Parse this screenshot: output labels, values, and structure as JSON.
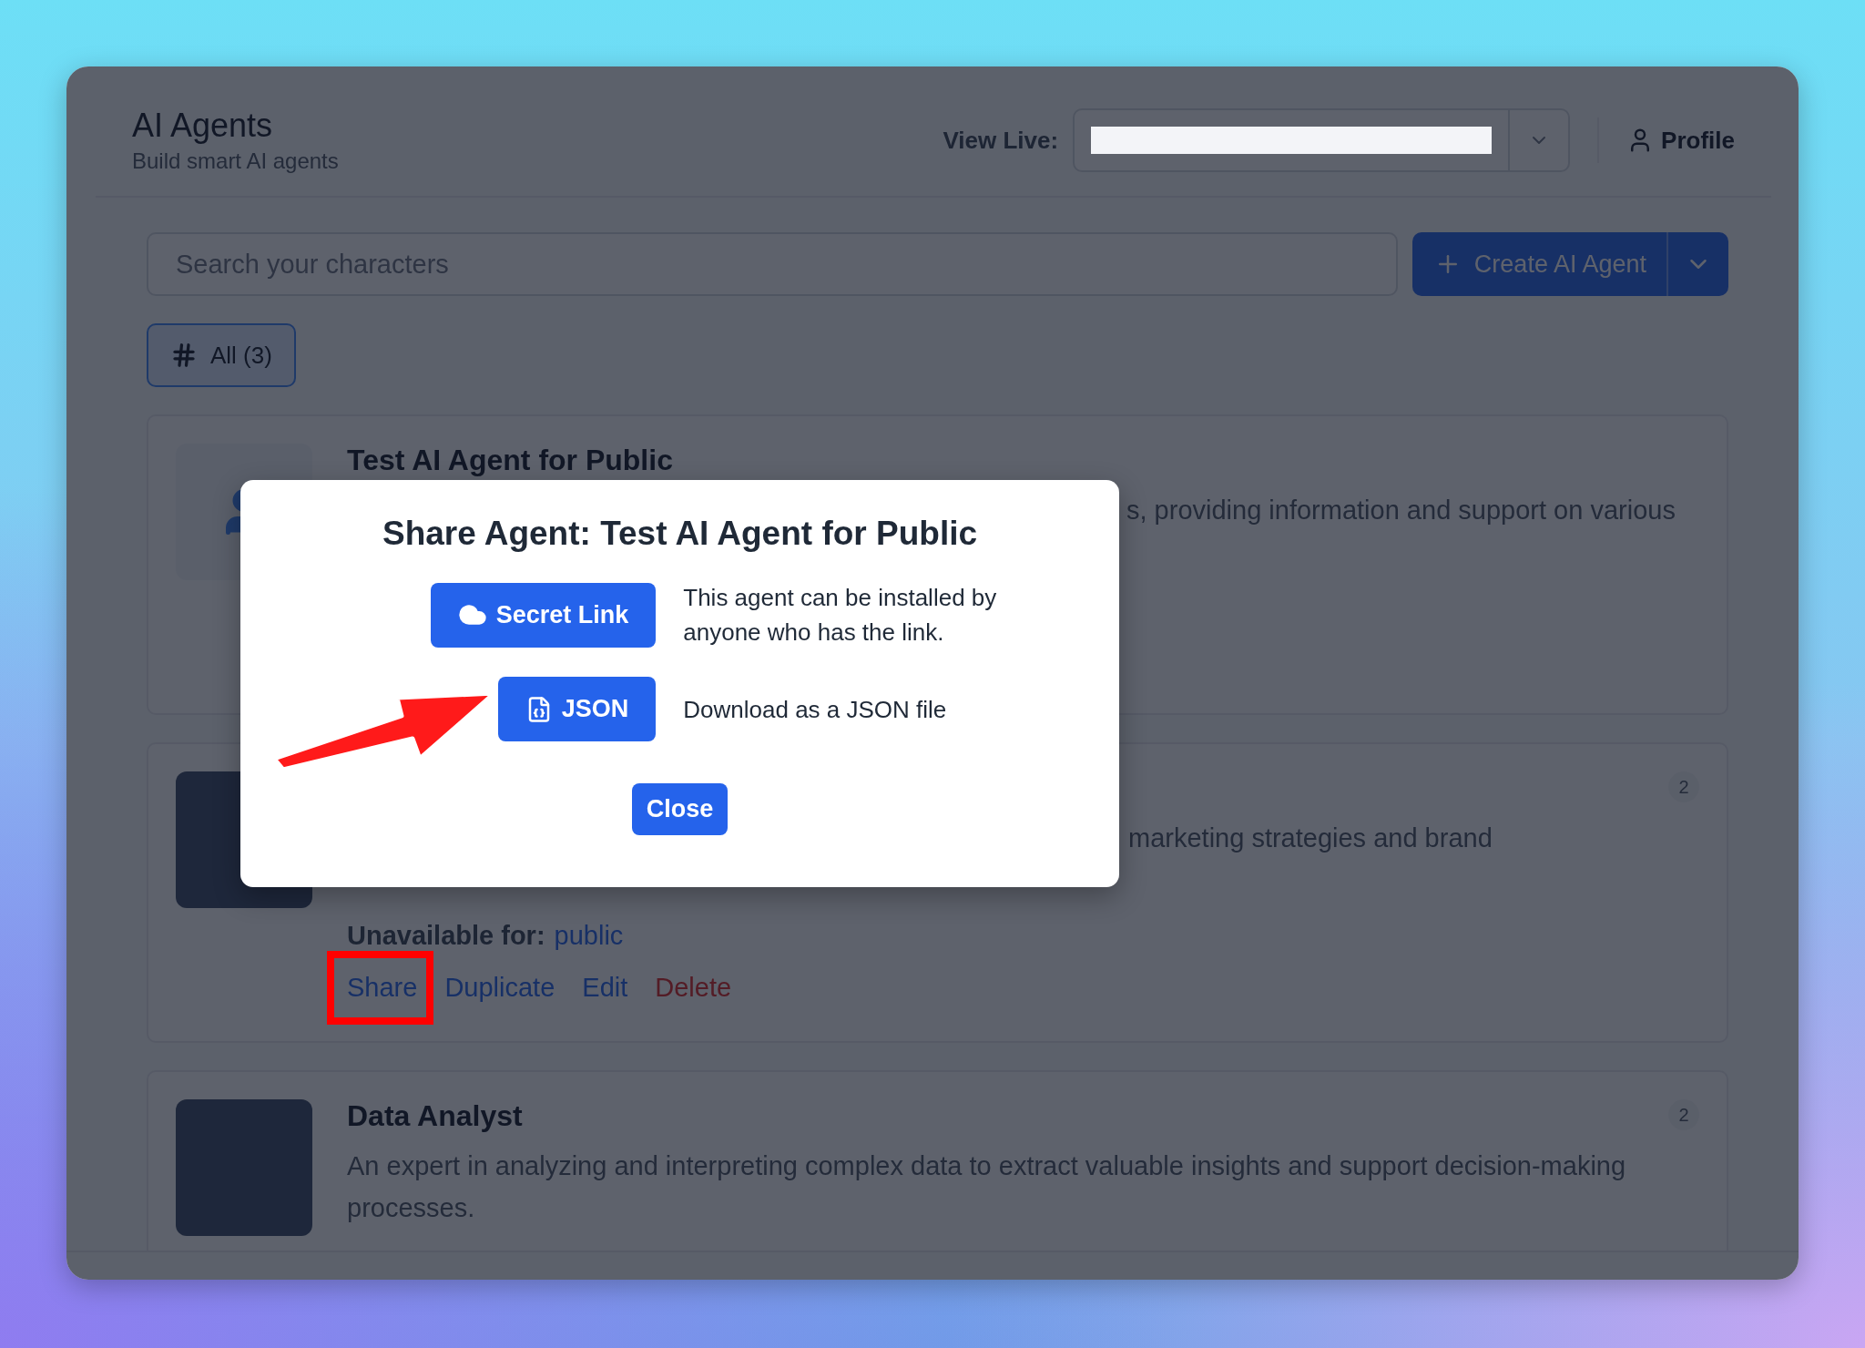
{
  "header": {
    "title": "AI Agents",
    "subtitle": "Build smart AI agents",
    "view_live_label": "View Live:",
    "profile": "Profile"
  },
  "toolbar": {
    "search": {
      "placeholder": "Search your characters"
    },
    "create_button": "Create AI Agent"
  },
  "filters": [
    {
      "label": "All (3)",
      "selected": true
    }
  ],
  "agents": [
    {
      "kind": "avatar",
      "title": "Test AI Agent for Public",
      "description": "s, providing information and support on various"
    },
    {
      "kind": "photo",
      "description": "marketing strategies and brand",
      "badge": "2",
      "availability_label": "Unavailable for:",
      "availability_value": "public",
      "actions": [
        {
          "kind": "link",
          "label": "Share",
          "highlighted": true
        },
        {
          "kind": "link",
          "label": "Duplicate",
          "highlighted": false
        },
        {
          "kind": "link",
          "label": "Edit",
          "highlighted": false
        },
        {
          "kind": "danger",
          "label": "Delete",
          "highlighted": false
        }
      ]
    },
    {
      "kind": "photo",
      "title": "Data Analyst",
      "description": "An expert in analyzing and interpreting complex data to extract valuable insights and support decision-making processes.",
      "badge": "2"
    }
  ],
  "modal": {
    "title": "Share Agent: Test AI Agent for Public",
    "options": [
      {
        "kind": "link",
        "label": "Secret Link",
        "description": "This agent can be installed by anyone who has the link."
      },
      {
        "kind": "json",
        "label": "JSON",
        "description": "Download as a JSON file",
        "arrow": true
      }
    ],
    "close": "Close"
  }
}
